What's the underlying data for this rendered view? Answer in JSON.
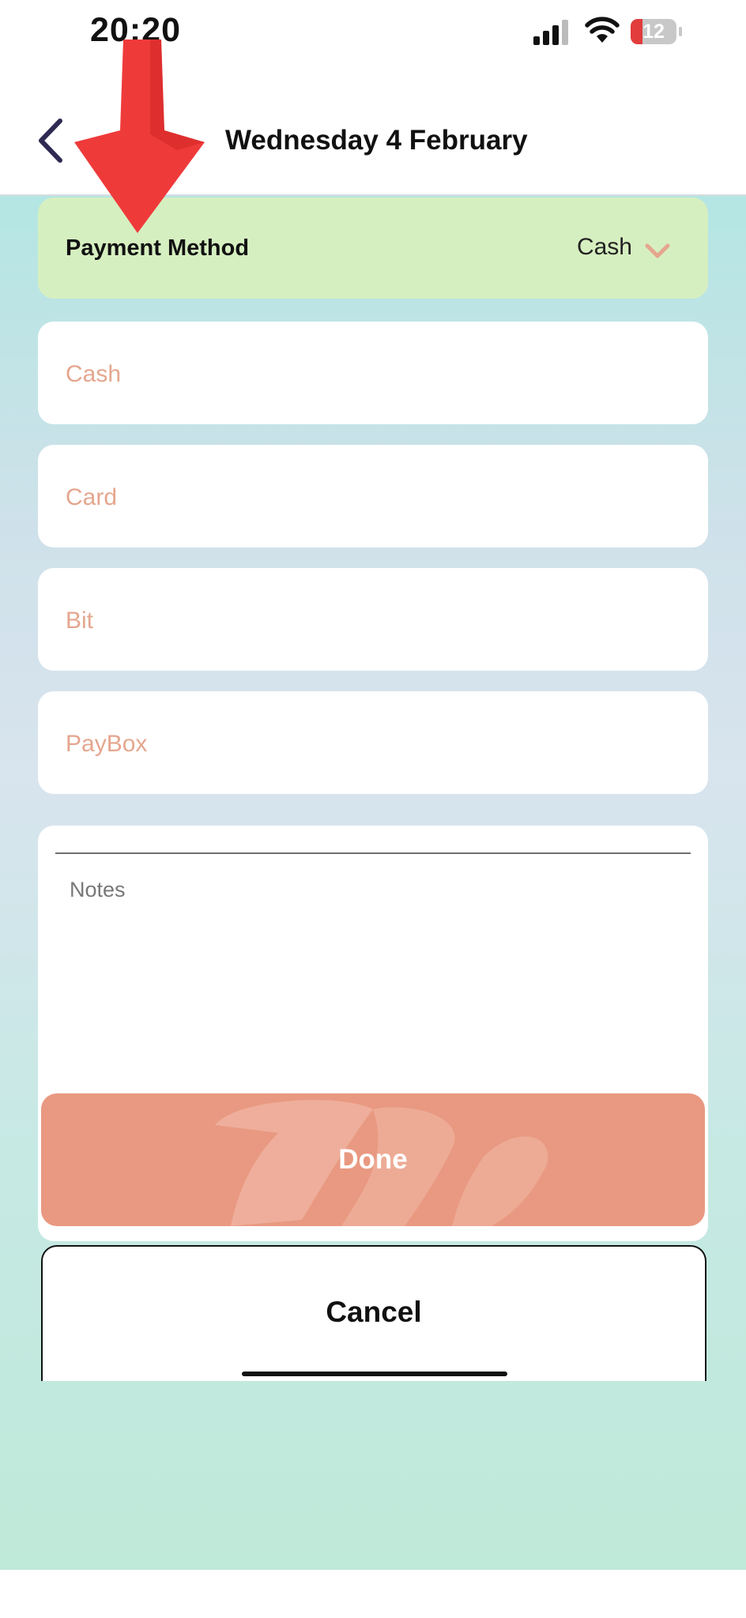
{
  "status_bar": {
    "time": "20:20",
    "battery": "12"
  },
  "header": {
    "title": "Wednesday 4 February"
  },
  "payment": {
    "label": "Payment Method",
    "value": "Cash"
  },
  "fields": [
    {
      "placeholder": "Cash"
    },
    {
      "placeholder": "Card"
    },
    {
      "placeholder": "Bit"
    },
    {
      "placeholder": "PayBox"
    }
  ],
  "notes": {
    "placeholder": "Notes"
  },
  "buttons": {
    "done": "Done",
    "cancel": "Cancel"
  },
  "icons": {
    "back": "chevron-left-icon",
    "dropdown": "chevron-down-icon",
    "annotation": "red-arrow-icon"
  },
  "colors": {
    "accent": "#e99981",
    "field_placeholder": "#e5a68e",
    "payment_row": "#d6efc0",
    "back_icon": "#2e2a52",
    "annotation_arrow": "#ef3a3a"
  }
}
